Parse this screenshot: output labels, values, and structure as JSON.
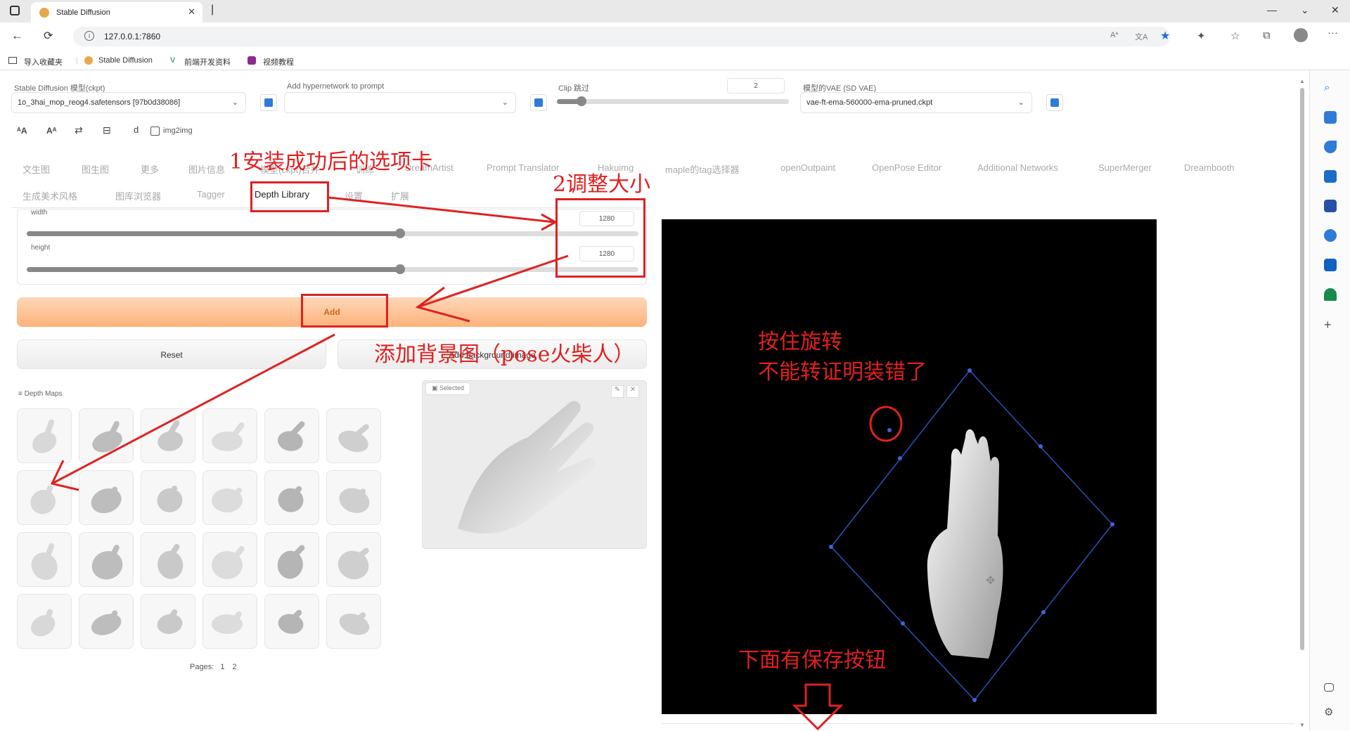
{
  "browser": {
    "tab_title": "Stable Diffusion",
    "url": "127.0.0.1:7860",
    "bookmarks": [
      "导入收藏夹",
      "Stable Diffusion",
      "前端开发资料",
      "视频教程"
    ]
  },
  "top": {
    "model_label": "Stable Diffusion 模型(ckpt)",
    "model_value": "1o_3hai_mop_reog4.safetensors [97b0d38086]",
    "hypernet_label": "Add hypernetwork to prompt",
    "hypernet_value": "",
    "clip_label": "Clip 跳过",
    "clip_value": "2",
    "vae_label": "模型的VAE (SD VAE)",
    "vae_value": "vae-ft-ema-560000-ema-pruned.ckpt",
    "img2img_label": "img2img"
  },
  "tabs_row1": [
    "文生图",
    "图生图",
    "更多",
    "图片信息",
    "模型(ckpt)合并",
    "训练",
    "DreamArtist",
    "Prompt Translator",
    "Hakuimg",
    "maple的tag选择器",
    "openOutpaint",
    "OpenPose Editor",
    "Additional Networks",
    "SuperMerger",
    "Dreambooth"
  ],
  "tabs_row2": [
    "生成美术风格",
    "图库浏览器",
    "Tagger",
    "Depth Library",
    "设置",
    "扩展"
  ],
  "panel": {
    "width_label": "width",
    "width_value": "1280",
    "height_label": "height",
    "height_value": "1280",
    "add_label": "Add",
    "reset_label": "Reset",
    "bg_label": "Add background image",
    "maps_label": "Depth Maps",
    "selected_label": "Selected",
    "pages_label": "Pages:",
    "pages": [
      "1",
      "2"
    ]
  },
  "annotations": {
    "a1": "1安装成功后的选项卡",
    "a2": "2调整大小",
    "a3": "添加背景图（pose火柴人）",
    "a4_line1": "按住旋转",
    "a4_line2": "不能转证明装错了",
    "a5": "下面有保存按钮"
  },
  "colors": {
    "accent": "#fdb27a",
    "annotation": "#e02020",
    "canvas": "#000000"
  }
}
